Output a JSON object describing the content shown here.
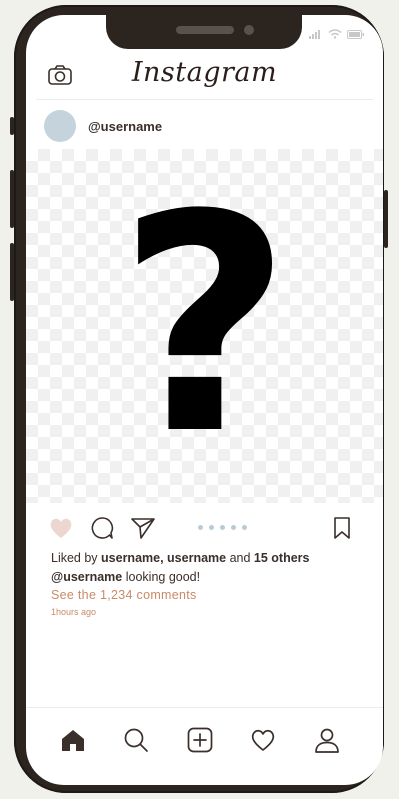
{
  "app": {
    "title": "Instagram"
  },
  "status_bar": {
    "icons": [
      "signal-icon",
      "wifi-icon",
      "battery-icon"
    ]
  },
  "post": {
    "username": "@username",
    "image_icon": "question-mark-icon",
    "image_symbol": "?",
    "likes": {
      "prefix": "Liked by ",
      "users": "username, username",
      "middle": " and ",
      "others": "15 others"
    },
    "caption": {
      "user": "@username",
      "text": "looking good!"
    },
    "comments_link": "See the 1,234 comments",
    "timestamp": "1hours ago",
    "carousel_dots": 5
  },
  "colors": {
    "accent": "#c98a66",
    "like_fill": "#ecd6d0",
    "phone_frame": "#2b241f",
    "avatar": "#c5d4dc",
    "dot": "#b9ccd6"
  },
  "tabbar": {
    "items": [
      "home-icon",
      "search-icon",
      "add-post-icon",
      "activity-icon",
      "profile-icon"
    ]
  }
}
